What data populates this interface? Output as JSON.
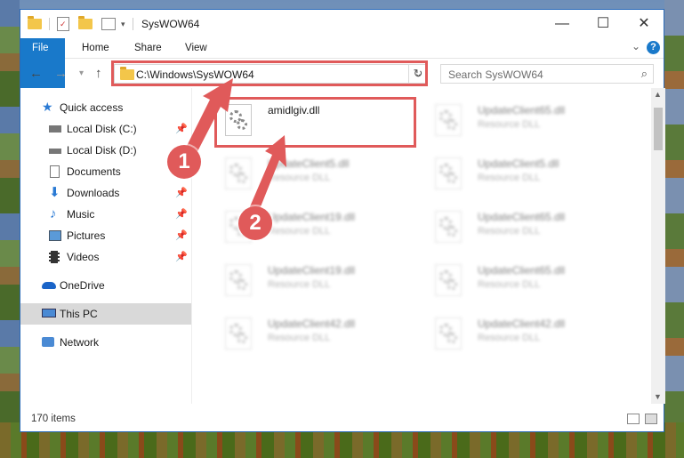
{
  "window": {
    "title": "SysWOW64",
    "controls": {
      "minimize": "—",
      "maximize": "☐",
      "close": "✕"
    }
  },
  "ribbon": {
    "tabs": [
      "File",
      "Home",
      "Share",
      "View"
    ],
    "help_label": "?"
  },
  "nav": {
    "address": "C:\\Windows\\SysWOW64",
    "search_placeholder": "Search SysWOW64"
  },
  "sidebar": {
    "items": [
      {
        "label": "Quick access",
        "icon": "star-icon",
        "pinned": false
      },
      {
        "label": "Local Disk (C:)",
        "icon": "drive-icon",
        "pinned": true
      },
      {
        "label": "Local Disk (D:)",
        "icon": "drive-icon",
        "pinned": false
      },
      {
        "label": "Documents",
        "icon": "document-icon",
        "pinned": true
      },
      {
        "label": "Downloads",
        "icon": "download-icon",
        "pinned": true
      },
      {
        "label": "Music",
        "icon": "music-icon",
        "pinned": true
      },
      {
        "label": "Pictures",
        "icon": "pictures-icon",
        "pinned": true
      },
      {
        "label": "Videos",
        "icon": "videos-icon",
        "pinned": true
      },
      {
        "label": "OneDrive",
        "icon": "cloud-icon",
        "pinned": false
      },
      {
        "label": "This PC",
        "icon": "computer-icon",
        "pinned": false
      },
      {
        "label": "Network",
        "icon": "network-icon",
        "pinned": false
      }
    ]
  },
  "files": [
    {
      "name": "amidlgiv.dll",
      "type": ""
    },
    {
      "name": "UpdateClient65.dll",
      "type": "Resource DLL"
    },
    {
      "name": "UpdateClient5.dll",
      "type": "Resource DLL"
    },
    {
      "name": "UpdateClient5.dll",
      "type": "Resource DLL"
    },
    {
      "name": "UpdateClient19.dll",
      "type": "Resource DLL"
    },
    {
      "name": "UpdateClient65.dll",
      "type": "Resource DLL"
    },
    {
      "name": "UpdateClient19.dll",
      "type": "Resource DLL"
    },
    {
      "name": "UpdateClient65.dll",
      "type": "Resource DLL"
    },
    {
      "name": "UpdateClient42.dll",
      "type": "Resource DLL"
    },
    {
      "name": "UpdateClient42.dll",
      "type": "Resource DLL"
    }
  ],
  "status": {
    "item_count": "170 items"
  },
  "annotations": {
    "step1": "1",
    "step2": "2",
    "color": "#e05a5a"
  }
}
